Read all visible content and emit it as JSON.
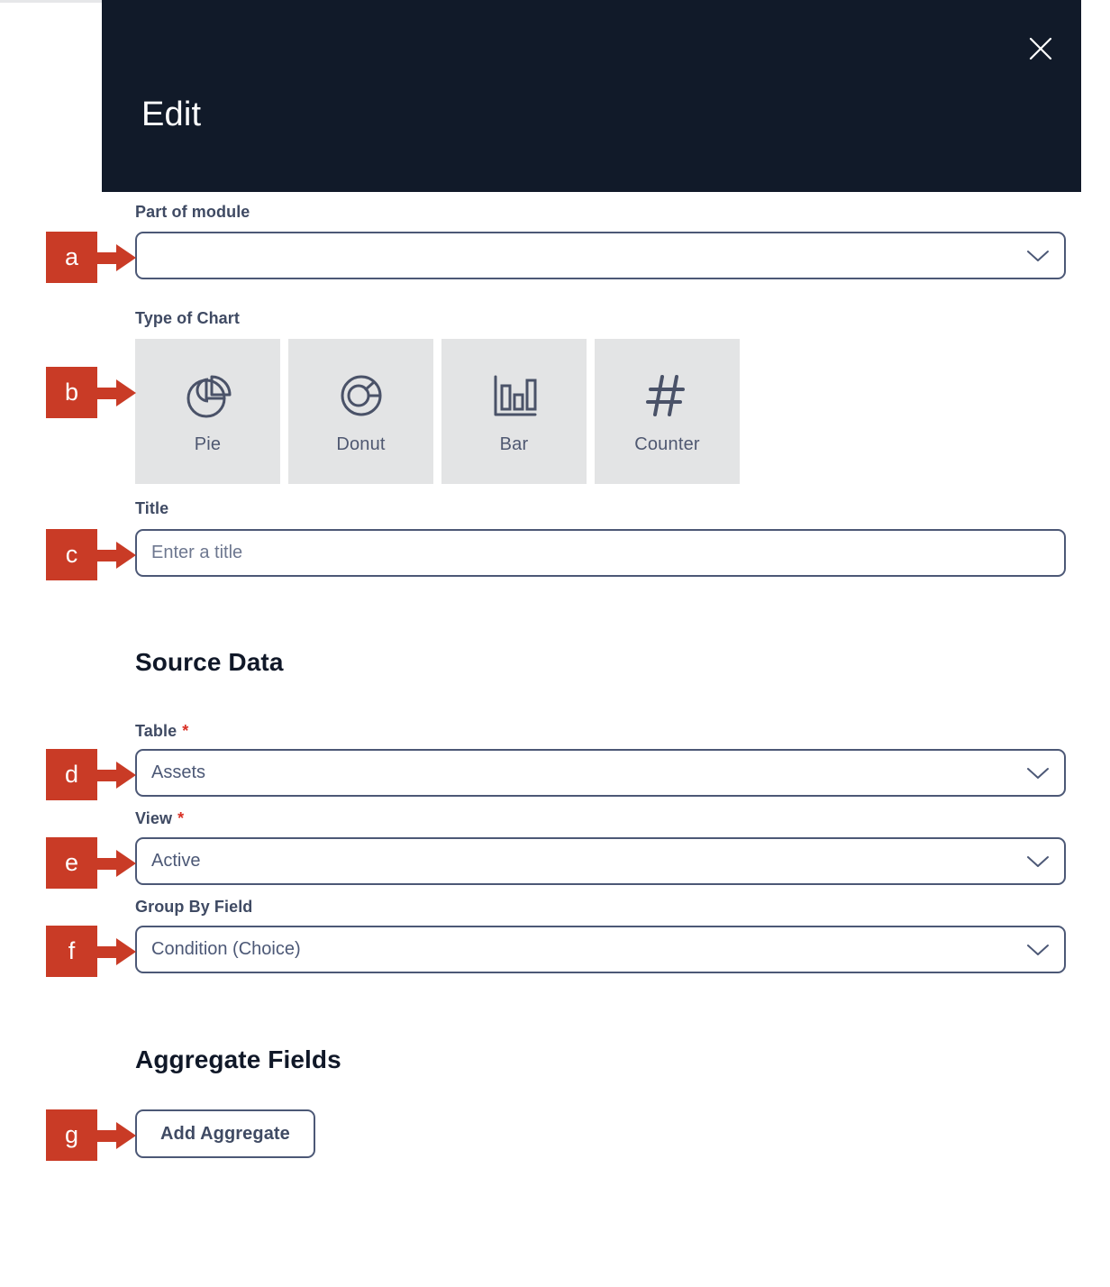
{
  "modal": {
    "title": "Edit",
    "close_icon": "close-icon"
  },
  "form": {
    "part_of_module": {
      "label": "Part of module",
      "value": "",
      "chevron_icon": "chevron-down-icon"
    },
    "type_of_chart": {
      "label": "Type of Chart",
      "options": [
        {
          "label": "Pie",
          "icon": "pie-chart-icon"
        },
        {
          "label": "Donut",
          "icon": "donut-chart-icon"
        },
        {
          "label": "Bar",
          "icon": "bar-chart-icon"
        },
        {
          "label": "Counter",
          "icon": "hash-counter-icon"
        }
      ]
    },
    "title_field": {
      "label": "Title",
      "value": "",
      "placeholder": "Enter a title"
    }
  },
  "source_data": {
    "heading": "Source Data",
    "table": {
      "label": "Table",
      "required_marker": "*",
      "value": "Assets",
      "chevron_icon": "chevron-down-icon"
    },
    "view": {
      "label": "View",
      "required_marker": "*",
      "value": "Active",
      "chevron_icon": "chevron-down-icon"
    },
    "group_by_field": {
      "label": "Group By Field",
      "value": "Condition (Choice)",
      "chevron_icon": "chevron-down-icon"
    }
  },
  "aggregate_fields": {
    "heading": "Aggregate Fields",
    "add_button_label": "Add Aggregate"
  },
  "annotations": {
    "color": "#c93b26",
    "markers": [
      {
        "id": "a",
        "label": "a",
        "target": "part-of-module-select"
      },
      {
        "id": "b",
        "label": "b",
        "target": "type-of-chart-tiles"
      },
      {
        "id": "c",
        "label": "c",
        "target": "title-input"
      },
      {
        "id": "d",
        "label": "d",
        "target": "table-select"
      },
      {
        "id": "e",
        "label": "e",
        "target": "view-select"
      },
      {
        "id": "f",
        "label": "f",
        "target": "group-by-field-select"
      },
      {
        "id": "g",
        "label": "g",
        "target": "add-aggregate-button"
      }
    ]
  },
  "theme": {
    "header_bg": "#111a29",
    "border": "#4c5876",
    "tile_bg": "#e3e4e5",
    "text": "#3f4a63",
    "required": "#d93025"
  }
}
